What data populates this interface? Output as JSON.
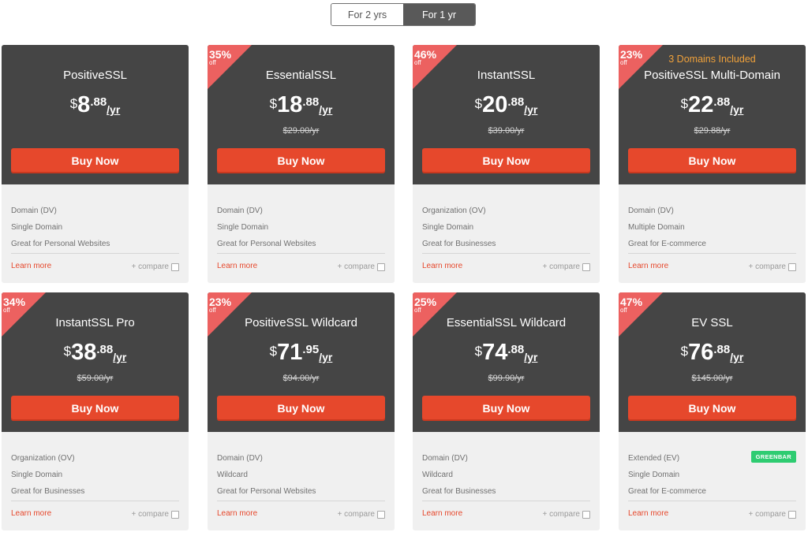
{
  "toggle": {
    "options": [
      "For 2 yrs",
      "For 1 yr"
    ],
    "active": "For 1 yr"
  },
  "cards": [
    {
      "name": "PositiveSSL",
      "extra": "",
      "badge_pct": "",
      "badge_off": "",
      "currency": "$",
      "price_int": "8",
      "price_dec": ".88",
      "per": "/yr",
      "was": "",
      "buy": "Buy Now",
      "features": [
        "Domain (DV)",
        "Single Domain",
        "Great for Personal Websites"
      ],
      "greenbar": "",
      "learn": "Learn more",
      "compare": "+ compare"
    },
    {
      "name": "EssentialSSL",
      "extra": "",
      "badge_pct": "35%",
      "badge_off": "off",
      "currency": "$",
      "price_int": "18",
      "price_dec": ".88",
      "per": "/yr",
      "was": "$29.00/yr",
      "buy": "Buy Now",
      "features": [
        "Domain (DV)",
        "Single Domain",
        "Great for Personal Websites"
      ],
      "greenbar": "",
      "learn": "Learn more",
      "compare": "+ compare"
    },
    {
      "name": "InstantSSL",
      "extra": "",
      "badge_pct": "46%",
      "badge_off": "off",
      "currency": "$",
      "price_int": "20",
      "price_dec": ".88",
      "per": "/yr",
      "was": "$39.00/yr",
      "buy": "Buy Now",
      "features": [
        "Organization (OV)",
        "Single Domain",
        "Great for Businesses"
      ],
      "greenbar": "",
      "learn": "Learn more",
      "compare": "+ compare"
    },
    {
      "name": "PositiveSSL Multi-Domain",
      "extra": "3 Domains Included",
      "badge_pct": "23%",
      "badge_off": "off",
      "currency": "$",
      "price_int": "22",
      "price_dec": ".88",
      "per": "/yr",
      "was": "$29.88/yr",
      "buy": "Buy Now",
      "features": [
        "Domain (DV)",
        "Multiple Domain",
        "Great for E-commerce"
      ],
      "greenbar": "",
      "learn": "Learn more",
      "compare": "+ compare"
    },
    {
      "name": "InstantSSL Pro",
      "extra": "",
      "badge_pct": "34%",
      "badge_off": "off",
      "currency": "$",
      "price_int": "38",
      "price_dec": ".88",
      "per": "/yr",
      "was": "$59.00/yr",
      "buy": "Buy Now",
      "features": [
        "Organization (OV)",
        "Single Domain",
        "Great for Businesses"
      ],
      "greenbar": "",
      "learn": "Learn more",
      "compare": "+ compare"
    },
    {
      "name": "PositiveSSL Wildcard",
      "extra": "",
      "badge_pct": "23%",
      "badge_off": "off",
      "currency": "$",
      "price_int": "71",
      "price_dec": ".95",
      "per": "/yr",
      "was": "$94.00/yr",
      "buy": "Buy Now",
      "features": [
        "Domain (DV)",
        "Wildcard",
        "Great for Personal Websites"
      ],
      "greenbar": "",
      "learn": "Learn more",
      "compare": "+ compare"
    },
    {
      "name": "EssentialSSL Wildcard",
      "extra": "",
      "badge_pct": "25%",
      "badge_off": "off",
      "currency": "$",
      "price_int": "74",
      "price_dec": ".88",
      "per": "/yr",
      "was": "$99.90/yr",
      "buy": "Buy Now",
      "features": [
        "Domain (DV)",
        "Wildcard",
        "Great for Businesses"
      ],
      "greenbar": "",
      "learn": "Learn more",
      "compare": "+ compare"
    },
    {
      "name": "EV SSL",
      "extra": "",
      "badge_pct": "47%",
      "badge_off": "off",
      "currency": "$",
      "price_int": "76",
      "price_dec": ".88",
      "per": "/yr",
      "was": "$145.00/yr",
      "buy": "Buy Now",
      "features": [
        "Extended (EV)",
        "Single Domain",
        "Great for E-commerce"
      ],
      "greenbar": "GREENBAR",
      "learn": "Learn more",
      "compare": "+ compare"
    }
  ],
  "colors": {
    "card_top": "#454545",
    "card_bottom": "#f0f0f0",
    "buy_button": "#e6482c",
    "badge": "#ec6160",
    "greenbar": "#2ecc71",
    "extra_text": "#f0a13a"
  }
}
